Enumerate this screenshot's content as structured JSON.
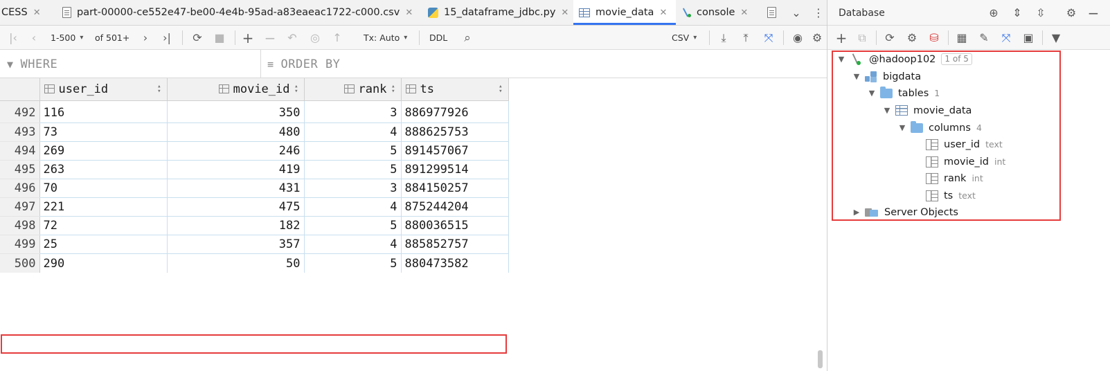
{
  "tabs": [
    {
      "label": "CESS",
      "icon": "none"
    },
    {
      "label": "part-00000-ce552e47-be00-4e4b-95ad-a83eaeac1722-c000.csv",
      "icon": "file-icon"
    },
    {
      "label": "15_dataframe_jdbc.py",
      "icon": "python-file-icon"
    },
    {
      "label": "movie_data",
      "icon": "table-icon",
      "active": true
    },
    {
      "label": "console",
      "icon": "console-icon"
    }
  ],
  "toolbar": {
    "page_range": "1-500",
    "of_total": "of 501+",
    "tx_mode": "Tx: Auto",
    "ddl": "DDL",
    "export_format": "CSV"
  },
  "filter": {
    "where_placeholder": "WHERE",
    "order_by_placeholder": "ORDER BY"
  },
  "grid": {
    "columns": [
      "user_id",
      "movie_id",
      "rank",
      "ts"
    ],
    "rows": [
      {
        "n": "492",
        "user_id": "116",
        "movie_id": "350",
        "rank": "3",
        "ts": "886977926"
      },
      {
        "n": "493",
        "user_id": "73",
        "movie_id": "480",
        "rank": "4",
        "ts": "888625753"
      },
      {
        "n": "494",
        "user_id": "269",
        "movie_id": "246",
        "rank": "5",
        "ts": "891457067"
      },
      {
        "n": "495",
        "user_id": "263",
        "movie_id": "419",
        "rank": "5",
        "ts": "891299514"
      },
      {
        "n": "496",
        "user_id": "70",
        "movie_id": "431",
        "rank": "3",
        "ts": "884150257"
      },
      {
        "n": "497",
        "user_id": "221",
        "movie_id": "475",
        "rank": "4",
        "ts": "875244204"
      },
      {
        "n": "498",
        "user_id": "72",
        "movie_id": "182",
        "rank": "5",
        "ts": "880036515"
      },
      {
        "n": "499",
        "user_id": "25",
        "movie_id": "357",
        "rank": "4",
        "ts": "885852757"
      },
      {
        "n": "500",
        "user_id": "290",
        "movie_id": "50",
        "rank": "5",
        "ts": "880473582"
      }
    ]
  },
  "database": {
    "title": "Database",
    "datasource": "@hadoop102",
    "datasource_badge": "1 of 5",
    "schema": "bigdata",
    "tables_folder": "tables",
    "tables_count": "1",
    "table": "movie_data",
    "columns_folder": "columns",
    "columns_count": "4",
    "columns": [
      {
        "name": "user_id",
        "type": "text"
      },
      {
        "name": "movie_id",
        "type": "int"
      },
      {
        "name": "rank",
        "type": "int"
      },
      {
        "name": "ts",
        "type": "text"
      }
    ],
    "server_objects": "Server Objects"
  },
  "colors": {
    "accent": "#3574f0",
    "highlight_box": "#e63b3b",
    "selected_row": "#d5d5d5",
    "folder": "#7fb5e6"
  }
}
